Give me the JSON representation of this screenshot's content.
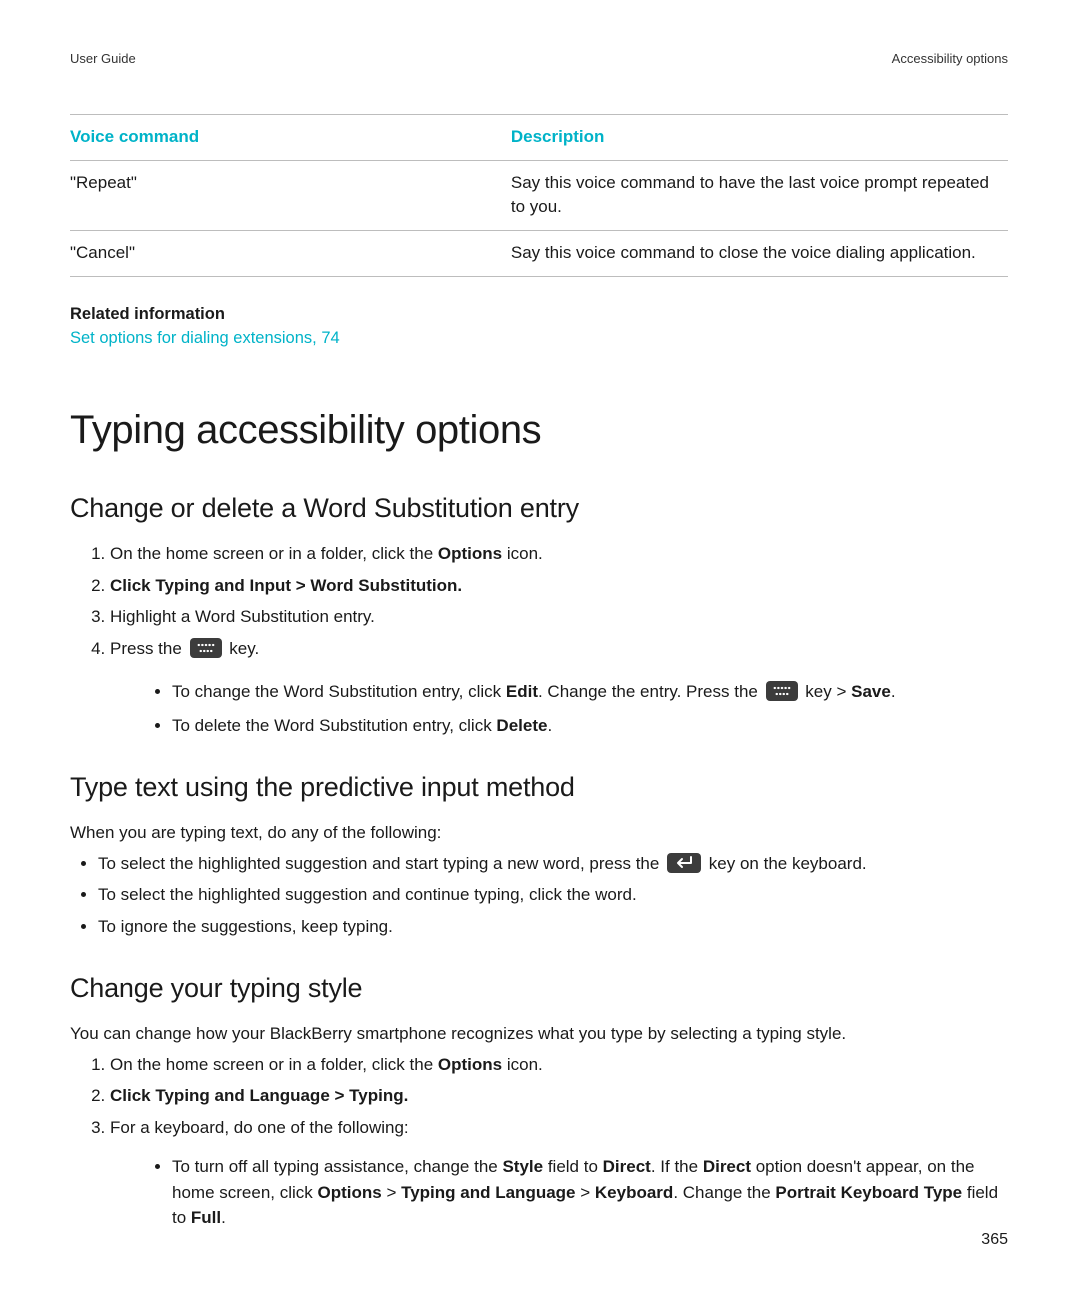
{
  "header": {
    "left": "User Guide",
    "right": "Accessibility options"
  },
  "table": {
    "headers": {
      "c1": "Voice command",
      "c2": "Description"
    },
    "rows": [
      {
        "cmd": "\"Repeat\"",
        "desc": "Say this voice command to have the last voice prompt repeated to you."
      },
      {
        "cmd": "\"Cancel\"",
        "desc": "Say this voice command to close the voice dialing application."
      }
    ]
  },
  "related": {
    "title": "Related information",
    "link_text": "Set options for dialing extensions, ",
    "link_page": "74"
  },
  "h1": "Typing accessibility options",
  "section1": {
    "title": "Change or delete a Word Substitution entry",
    "steps": {
      "s1_a": "On the home screen or in a folder, click the ",
      "s1_b": "Options",
      "s1_c": " icon.",
      "s2_a": "Click ",
      "s2_b": "Typing and Input",
      "s2_c": " > ",
      "s2_d": "Word Substitution",
      "s2_e": ".",
      "s3": "Highlight a Word Substitution entry.",
      "s4_a": "Press the ",
      "s4_b": " key."
    },
    "sub": {
      "b1_a": "To change the Word Substitution entry, click ",
      "b1_b": "Edit",
      "b1_c": ". Change the entry. Press the ",
      "b1_d": " key > ",
      "b1_e": "Save",
      "b1_f": ".",
      "b2_a": "To delete the Word Substitution entry, click ",
      "b2_b": "Delete",
      "b2_c": "."
    }
  },
  "section2": {
    "title": "Type text using the predictive input method",
    "intro": "When you are typing text, do any of the following:",
    "bullets": {
      "b1_a": "To select the highlighted suggestion and start typing a new word, press the ",
      "b1_b": " key on the keyboard.",
      "b2": "To select the highlighted suggestion and continue typing, click the word.",
      "b3": "To ignore the suggestions, keep typing."
    }
  },
  "section3": {
    "title": "Change your typing style",
    "intro": "You can change how your BlackBerry smartphone recognizes what you type by selecting a typing style.",
    "steps": {
      "s1_a": "On the home screen or in a folder, click the ",
      "s1_b": "Options",
      "s1_c": " icon.",
      "s2_a": "Click ",
      "s2_b": "Typing and Language",
      "s2_c": " > ",
      "s2_d": "Typing",
      "s2_e": ".",
      "s3": "For a keyboard, do one of the following:"
    },
    "sub": {
      "b1_a": "To turn off all typing assistance, change the ",
      "b1_b": "Style",
      "b1_c": " field to ",
      "b1_d": "Direct",
      "b1_e": ". If the ",
      "b1_f": "Direct",
      "b1_g": " option doesn't appear, on the home screen, click ",
      "b1_h": "Options",
      "b1_i": " > ",
      "b1_j": "Typing and Language",
      "b1_k": " > ",
      "b1_l": "Keyboard",
      "b1_m": ". Change the ",
      "b1_n": "Portrait Keyboard Type",
      "b1_o": " field to ",
      "b1_p": "Full",
      "b1_q": "."
    }
  },
  "page_number": "365"
}
